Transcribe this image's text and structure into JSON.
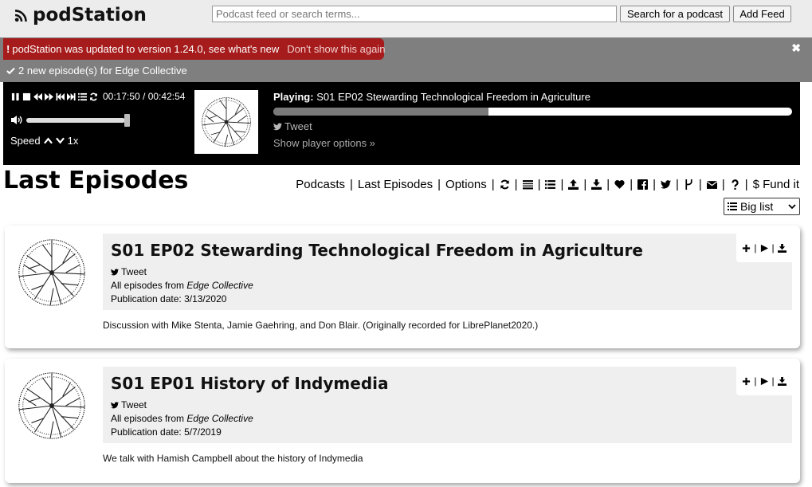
{
  "app": {
    "title": "podStation"
  },
  "header": {
    "search_placeholder": "Podcast feed or search terms...",
    "search_button": "Search for a podcast",
    "add_feed_button": "Add Feed"
  },
  "notifications": {
    "update_text": "podStation was updated to version 1.24.0, see what's new",
    "dont_show": "Don't show this again",
    "close_glyph": "✖",
    "new_episodes": "2 new episode(s) for Edge Collective"
  },
  "player": {
    "time": "00:17:50 / 00:42:54",
    "speed_label": "Speed",
    "speed_value": "1x",
    "playing_label": "Playing:",
    "playing_title": "S01 EP02 Stewarding Technological Freedom in Agriculture",
    "progress_fraction": 0.415,
    "volume_fraction": 1.0,
    "tweet": "Tweet",
    "options_link": "Show player options »"
  },
  "page": {
    "title": "Last Episodes",
    "nav": {
      "podcasts": "Podcasts",
      "last_episodes": "Last Episodes",
      "options": "Options",
      "fund_it": "$ Fund it"
    },
    "view_select": "Big list"
  },
  "episodes": [
    {
      "title": "S01 EP02 Stewarding Technological Freedom in Agriculture",
      "tweet": "Tweet",
      "from_label": "All episodes from",
      "podcast": "Edge Collective",
      "date": "Publication date: 3/13/2020",
      "description": "Discussion with Mike Stenta, Jamie Gaehring, and Don Blair. (Originally recorded for LibrePlanet2020.)"
    },
    {
      "title": "S01 EP01 History of Indymedia",
      "tweet": "Tweet",
      "from_label": "All episodes from",
      "podcast": "Edge Collective",
      "date": "Publication date: 5/7/2019",
      "description": "We talk with Hamish Campbell about the history of Indymedia"
    }
  ],
  "colors": {
    "header_bg": "#ececec",
    "update_red": "#a61b1b",
    "notice_gray": "#7f7f7f",
    "player_bg": "#000000",
    "card_head_bg": "#efefef"
  },
  "icons": [
    "rss-icon",
    "exclamation-icon",
    "close-icon",
    "check-icon",
    "pause-icon",
    "stop-icon",
    "rewind-icon",
    "forward-icon",
    "previous-icon",
    "next-icon",
    "playlist-icon",
    "loop-icon",
    "volume-icon",
    "chevron-up-icon",
    "chevron-down-icon",
    "twitter-icon",
    "refresh-icon",
    "list-icon",
    "upload-icon",
    "download-icon",
    "heart-icon",
    "facebook-icon",
    "git-icon",
    "mail-icon",
    "question-icon",
    "plus-icon",
    "play-icon"
  ]
}
